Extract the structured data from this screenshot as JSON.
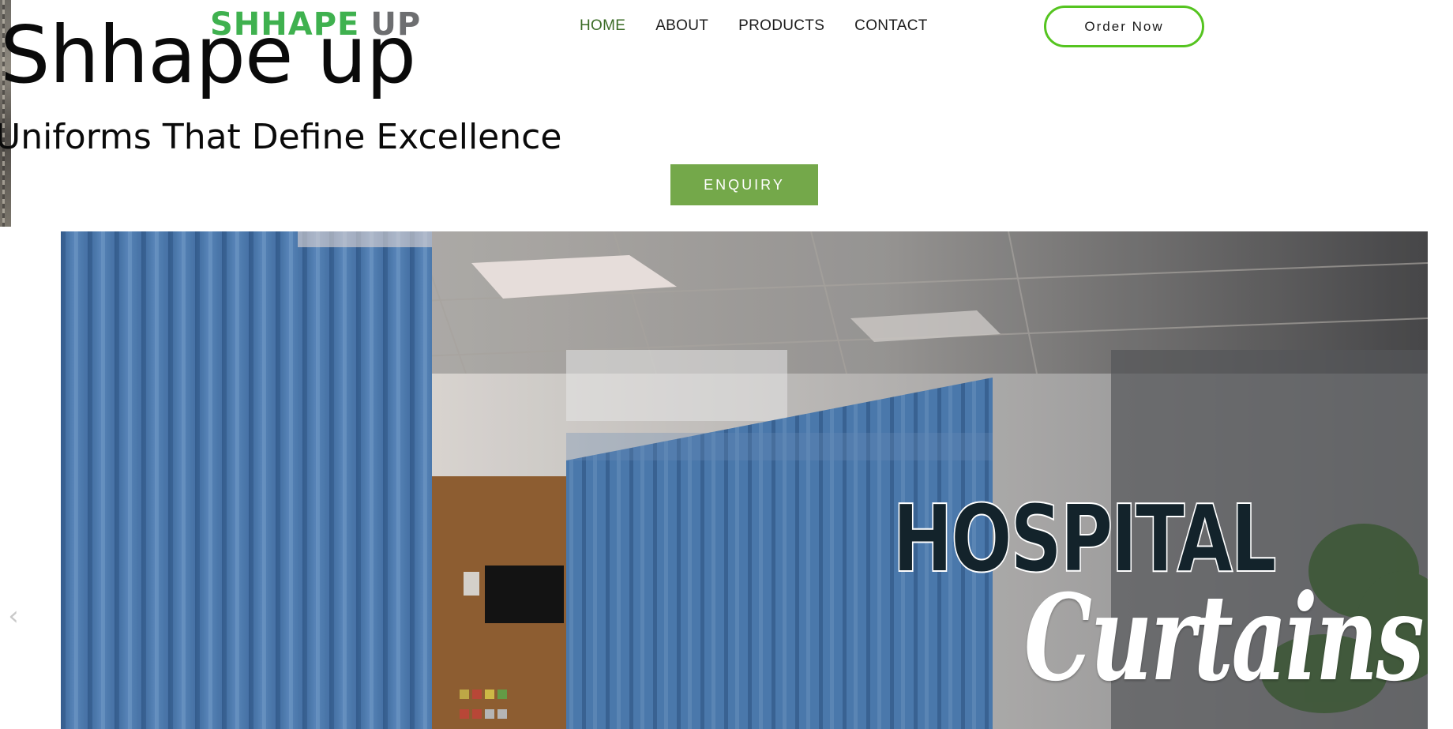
{
  "header": {
    "logo_primary": "SHHAPE",
    "logo_secondary": "UP",
    "nav": [
      {
        "label": "HOME",
        "active": true
      },
      {
        "label": "ABOUT",
        "active": false
      },
      {
        "label": "PRODUCTS",
        "active": false
      },
      {
        "label": "CONTACT",
        "active": false
      }
    ],
    "order_button": "Order Now"
  },
  "hero": {
    "title": "Shhape up",
    "subtitle": "Uniforms That Define Excellence",
    "enquiry_button": "ENQUIRY"
  },
  "banner": {
    "heading": "HOSPITAL",
    "subheading": "Curtains",
    "prev_icon": "chevron-left-icon"
  },
  "colors": {
    "brand_green": "#3fb14f",
    "brand_grey": "#6d6e70",
    "nav_active": "#3a6b25",
    "order_border": "#55c420",
    "enquiry_bg": "#74a84a",
    "curtain_blue": "#4f7fb5"
  }
}
